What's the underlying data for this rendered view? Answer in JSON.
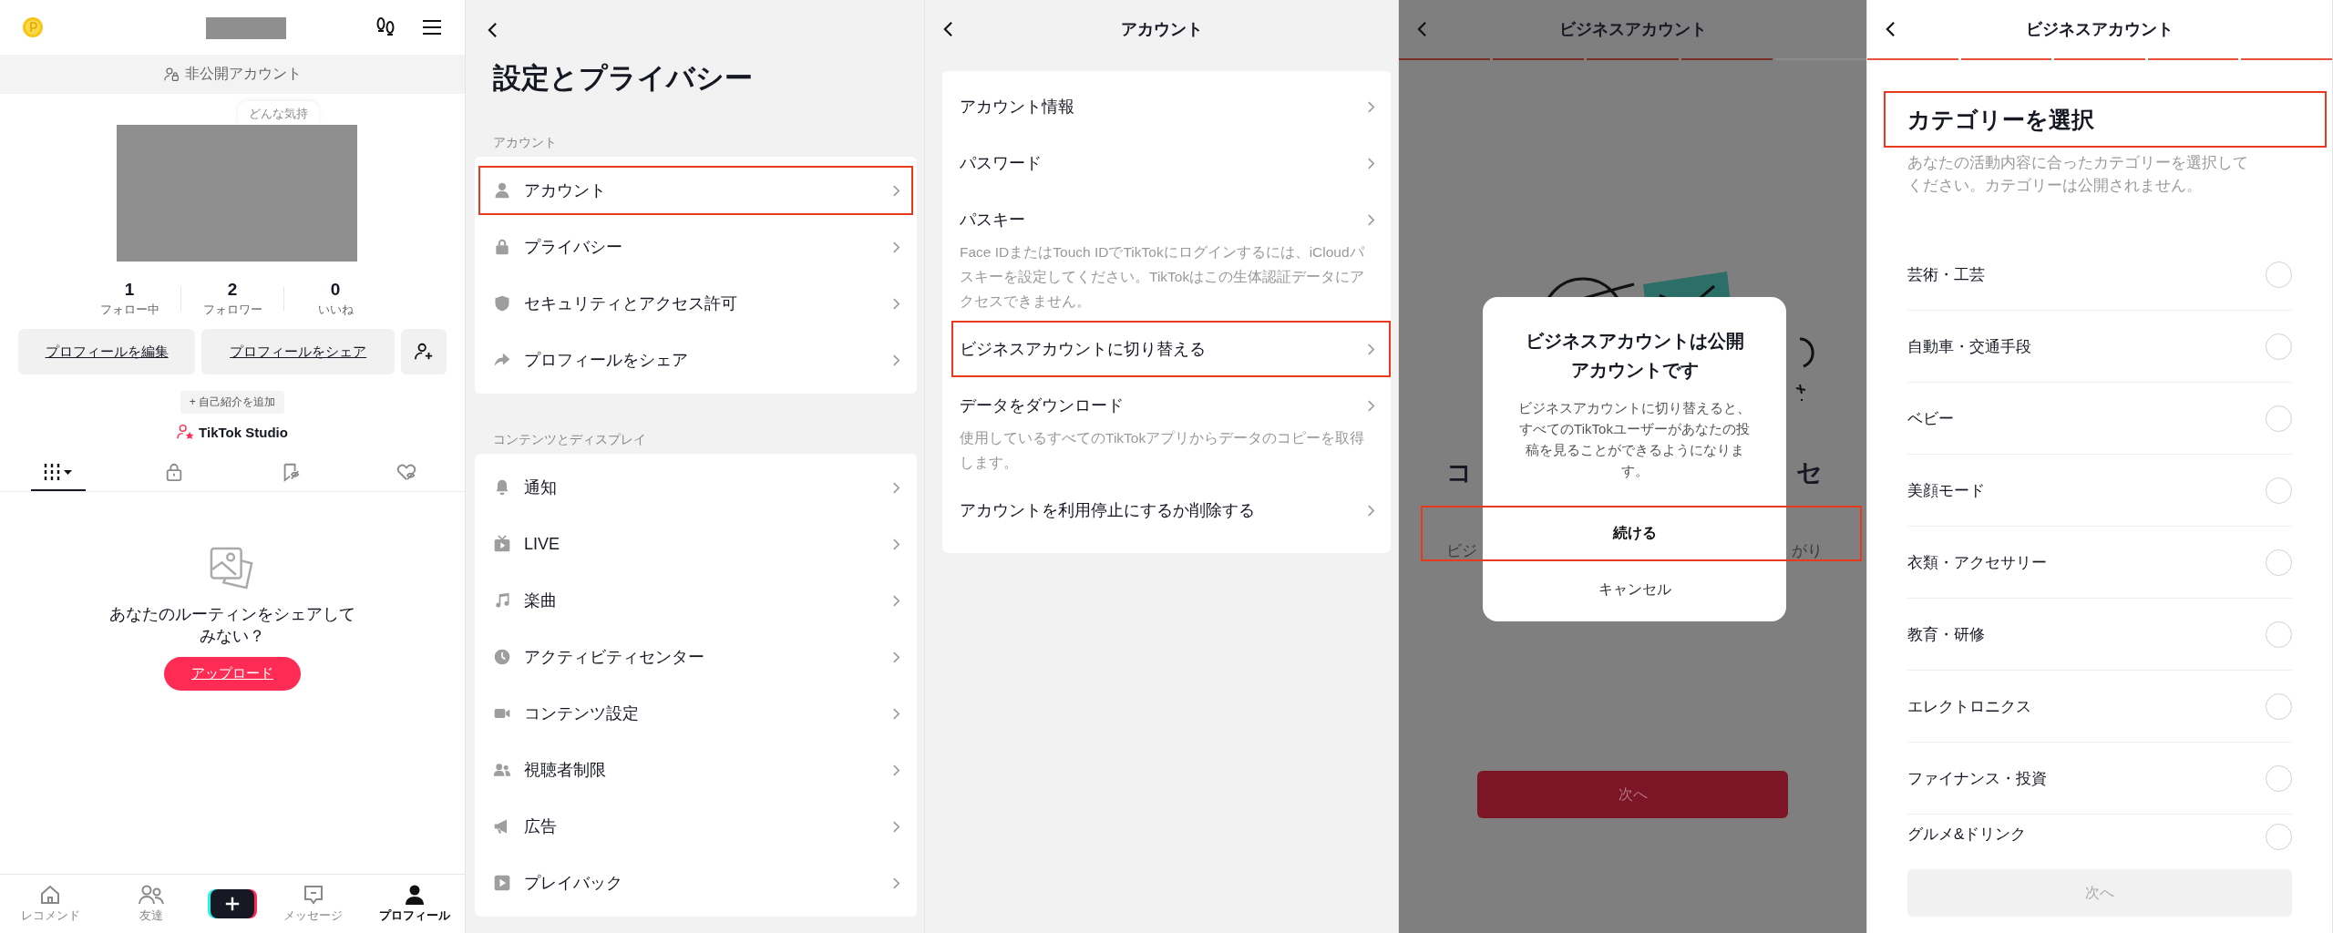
{
  "profile_screen": {
    "private_banner": "非公開アカウント",
    "mood_bubble": "どんな気持",
    "stats": [
      {
        "value": "1",
        "label": "フォロー中"
      },
      {
        "value": "2",
        "label": "フォロワー"
      },
      {
        "value": "0",
        "label": "いいね"
      }
    ],
    "buttons": [
      "プロフィールを編集",
      "プロフィールをシェア"
    ],
    "add_bio": "+ 自己紹介を追加",
    "studio_link": "TikTok Studio",
    "content_tabs": [
      {
        "kind": "videos",
        "selected": true
      },
      {
        "kind": "private",
        "selected": false
      },
      {
        "kind": "reposts",
        "selected": false
      },
      {
        "kind": "liked",
        "selected": false
      }
    ],
    "empty_state": {
      "message": "あなたのルーティンをシェアしてみない？",
      "button": "アップロード"
    },
    "bottom_nav": [
      {
        "kind": "home",
        "label": "レコメンド",
        "selected": false
      },
      {
        "kind": "friends",
        "label": "友達",
        "selected": false
      },
      {
        "kind": "create",
        "selected": false
      },
      {
        "kind": "inbox",
        "label": "メッセージ",
        "selected": false
      },
      {
        "kind": "profile",
        "label": "プロフィール",
        "selected": true
      }
    ]
  },
  "settings_screen": {
    "title": "設定とプライバシー",
    "sections": [
      {
        "heading": "アカウント",
        "items": [
          {
            "kind": "person",
            "label": "アカウント",
            "highlighted": true
          },
          {
            "kind": "lock",
            "label": "プライバシー",
            "highlighted": false
          },
          {
            "kind": "shield",
            "label": "セキュリティとアクセス許可",
            "highlighted": false
          },
          {
            "kind": "share",
            "label": "プロフィールをシェア",
            "highlighted": false
          }
        ]
      },
      {
        "heading": "コンテンツとディスプレイ",
        "items": [
          {
            "kind": "bell",
            "label": "通知",
            "highlighted": false
          },
          {
            "kind": "tv",
            "label": "LIVE",
            "highlighted": false
          },
          {
            "kind": "music",
            "label": "楽曲",
            "highlighted": false
          },
          {
            "kind": "clock",
            "label": "アクティビティセンター",
            "highlighted": false
          },
          {
            "kind": "video",
            "label": "コンテンツ設定",
            "highlighted": false
          },
          {
            "kind": "people",
            "label": "視聴者制限",
            "highlighted": false
          },
          {
            "kind": "megaphone",
            "label": "広告",
            "highlighted": false
          },
          {
            "kind": "play",
            "label": "プレイバック",
            "highlighted": false
          }
        ]
      }
    ]
  },
  "account_screen": {
    "title": "アカウント",
    "items": [
      {
        "label": "アカウント情報",
        "highlighted": false
      },
      {
        "label": "パスワード",
        "highlighted": false
      },
      {
        "label": "パスキー",
        "description": "Face IDまたはTouch IDでTikTokにログインするには、iCloudパスキーを設定してください。TikTokはこの生体認証データにアクセスできません。",
        "highlighted": false
      },
      {
        "label": "ビジネスアカウントに切り替える",
        "highlighted": true
      },
      {
        "label": "データをダウンロード",
        "description": "使用しているすべてのTikTokアプリからデータのコピーを取得します。",
        "highlighted": false
      },
      {
        "label": "アカウントを利用停止にするか削除する",
        "highlighted": false
      }
    ]
  },
  "business_intro_screen": {
    "title": "ビジネスアカウント",
    "progress": [
      {
        "completed": true
      },
      {
        "completed": true
      },
      {
        "completed": true
      },
      {
        "completed": true
      },
      {
        "completed": false
      }
    ],
    "heading_parts": [
      "コ",
      "セ"
    ],
    "text_parts": [
      "ビジ",
      "がり"
    ],
    "dialog": {
      "title": "ビジネスアカウントは公開アカウントです",
      "message": "ビジネスアカウントに切り替えると、すべてのTikTokユーザーがあなたの投稿を見ることができるようになります。",
      "actions": [
        {
          "kind": "primary",
          "label": "続ける",
          "highlighted": true
        },
        {
          "kind": "secondary",
          "label": "キャンセル",
          "highlighted": false
        }
      ]
    },
    "next_button": "次へ"
  },
  "category_screen": {
    "title": "ビジネスアカウント",
    "progress": [
      {
        "completed": true
      },
      {
        "completed": true
      },
      {
        "completed": true
      },
      {
        "completed": true
      },
      {
        "completed": true
      }
    ],
    "heading": "カテゴリーを選択",
    "heading_highlighted": true,
    "description": "あなたの活動内容に合ったカテゴリーを選択してください。カテゴリーは公開されません。",
    "categories": [
      {
        "label": "芸術・工芸",
        "selected": false
      },
      {
        "label": "自動車・交通手段",
        "selected": false
      },
      {
        "label": "ベビー",
        "selected": false
      },
      {
        "label": "美顔モード",
        "selected": false
      },
      {
        "label": "衣類・アクセサリー",
        "selected": false
      },
      {
        "label": "教育・研修",
        "selected": false
      },
      {
        "label": "エレクトロニクス",
        "selected": false
      },
      {
        "label": "ファイナンス・投資",
        "selected": false
      },
      {
        "label": "グルメ&ドリンク",
        "selected": false
      }
    ],
    "next_button": "次へ"
  }
}
